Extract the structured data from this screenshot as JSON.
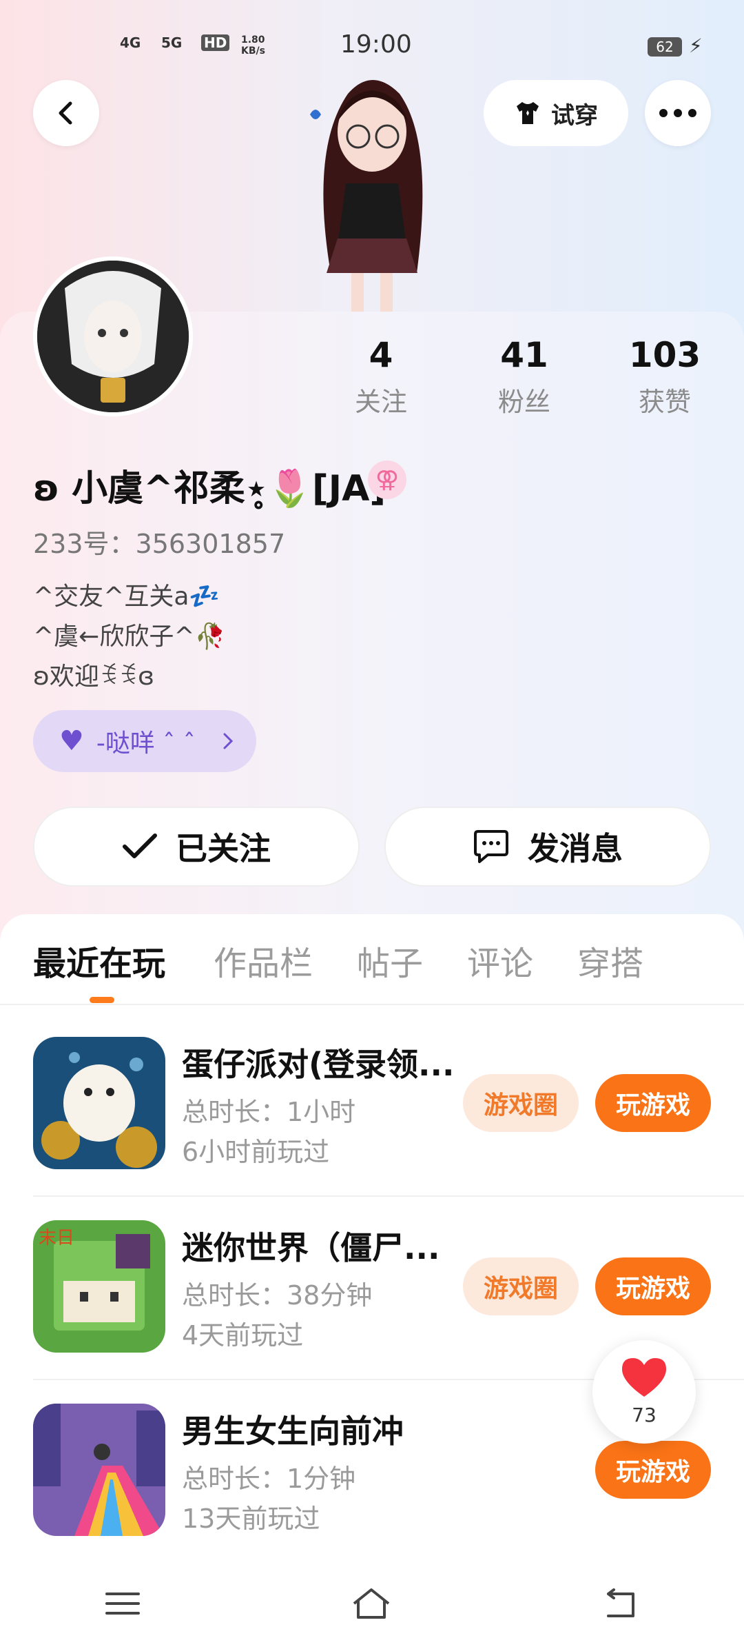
{
  "status_bar": {
    "net1": "4G",
    "net2": "5G",
    "hd": "HD",
    "speed": "1.80 KB/s",
    "time": "19:00",
    "battery": "62"
  },
  "header": {
    "tryon_label": "试穿"
  },
  "stats": [
    {
      "num": "4",
      "label": "关注"
    },
    {
      "num": "41",
      "label": "粉丝"
    },
    {
      "num": "103",
      "label": "获赞"
    }
  ],
  "profile": {
    "nickname": "ʚ 小虞^祁柔⋆̥🌷[JA]",
    "gender_symbol": "⚢",
    "uid": "233号：356301857",
    "bio_lines": [
      "^交友^互关a💤",
      "^虞←欣欣子^🥀",
      "ʚ欢迎ꉂꉂɞ"
    ],
    "tag_label": "-哒咩 ˆ ˆ"
  },
  "actions": {
    "follow_label": "已关注",
    "message_label": "发消息"
  },
  "tabs": [
    "最近在玩",
    "作品栏",
    "帖子",
    "评论",
    "穿搭"
  ],
  "games": [
    {
      "title": "蛋仔派对(登录领...",
      "duration": "总时长：1小时",
      "last_played": "6小时前玩过",
      "circle_label": "游戏圈",
      "play_label": "玩游戏"
    },
    {
      "title": "迷你世界（僵尸...",
      "duration": "总时长：38分钟",
      "last_played": "4天前玩过",
      "circle_label": "游戏圈",
      "play_label": "玩游戏"
    },
    {
      "title": "男生女生向前冲",
      "duration": "总时长：1分钟",
      "last_played": "13天前玩过",
      "play_label": "玩游戏"
    }
  ],
  "like_float": {
    "count": "73"
  },
  "colors": {
    "accent": "#fa7316",
    "circle_bg": "#fde8dc",
    "tag_bg": "#e3d9f6"
  }
}
